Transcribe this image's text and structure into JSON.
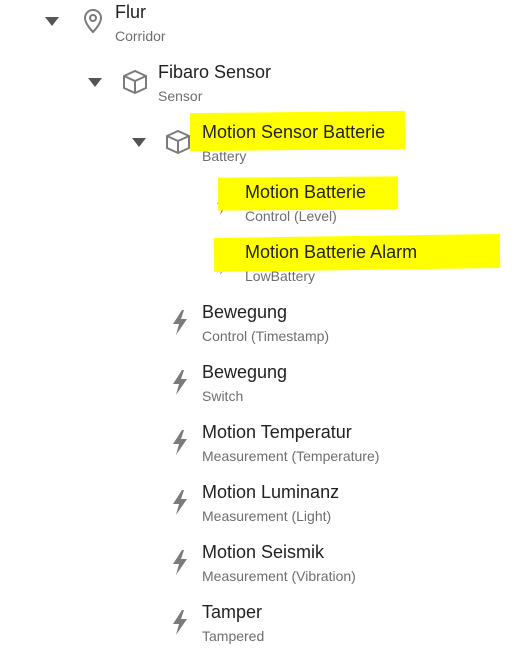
{
  "colors": {
    "highlight": "#ffff00",
    "title": "#222222",
    "subtitle": "#6e6e6e",
    "icon": "#7b7b7b"
  },
  "tree": {
    "location": {
      "title": "Flur",
      "subtitle": "Corridor",
      "icon": "location-pin-icon",
      "toggle": "expanded"
    },
    "equipment": {
      "title": "Fibaro Sensor",
      "subtitle": "Sensor",
      "icon": "cube-icon",
      "toggle": "expanded"
    },
    "group": {
      "title": "Motion Sensor Batterie",
      "subtitle": "Battery",
      "icon": "cube-icon",
      "toggle": "expanded",
      "highlighted": true
    },
    "group_items": [
      {
        "title": "Motion Batterie",
        "subtitle": "Control (Level)",
        "icon": "lightning-icon",
        "highlighted": true
      },
      {
        "title": "Motion Batterie Alarm",
        "subtitle": "LowBattery",
        "icon": "lightning-icon",
        "highlighted": true
      }
    ],
    "items": [
      {
        "title": "Bewegung",
        "subtitle": "Control (Timestamp)",
        "icon": "lightning-icon"
      },
      {
        "title": "Bewegung",
        "subtitle": "Switch",
        "icon": "lightning-icon"
      },
      {
        "title": "Motion Temperatur",
        "subtitle": "Measurement (Temperature)",
        "icon": "lightning-icon"
      },
      {
        "title": "Motion Luminanz",
        "subtitle": "Measurement (Light)",
        "icon": "lightning-icon"
      },
      {
        "title": "Motion Seismik",
        "subtitle": "Measurement (Vibration)",
        "icon": "lightning-icon"
      },
      {
        "title": "Tamper",
        "subtitle": "Tampered",
        "icon": "lightning-icon"
      }
    ]
  }
}
